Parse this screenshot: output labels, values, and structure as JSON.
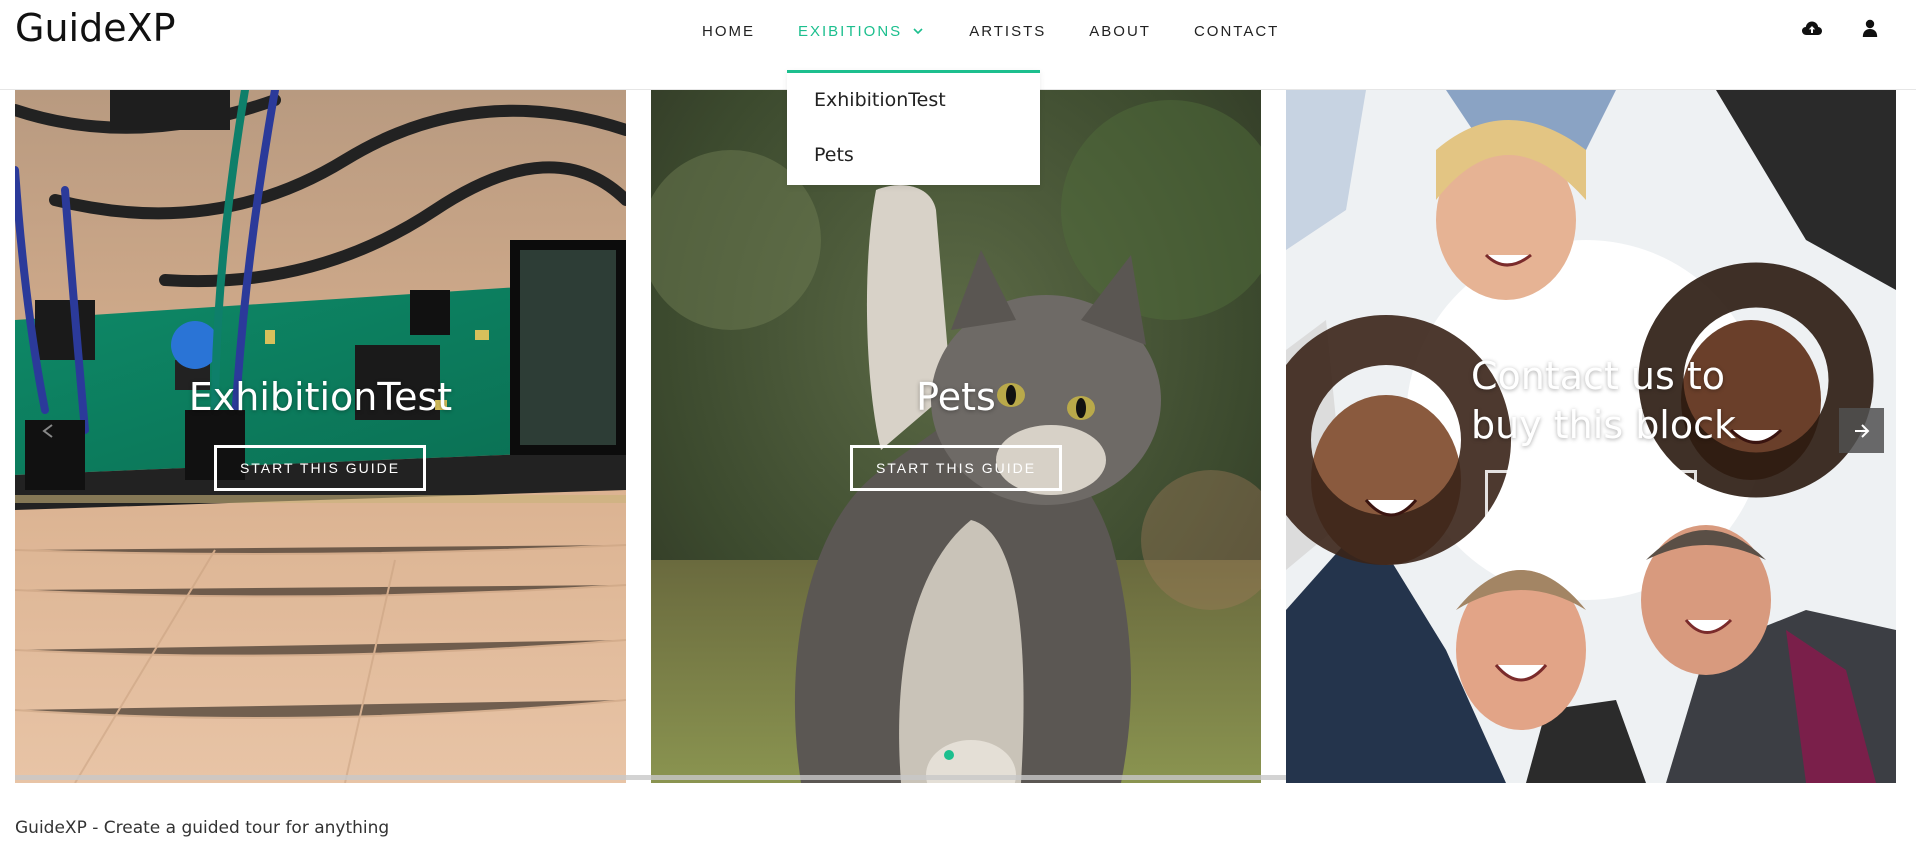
{
  "brand": {
    "name": "GuideXP"
  },
  "nav": {
    "items": [
      {
        "label": "HOME"
      },
      {
        "label": "EXIBITIONS"
      },
      {
        "label": "ARTISTS"
      },
      {
        "label": "ABOUT"
      },
      {
        "label": "CONTACT"
      }
    ],
    "active": "EXIBITIONS"
  },
  "dropdown": {
    "items": [
      {
        "label": "ExhibitionTest"
      },
      {
        "label": "Pets"
      }
    ]
  },
  "header_icons": [
    "cloud-upload-icon",
    "user-icon"
  ],
  "slides": [
    {
      "title": "ExhibitionTest",
      "button": "START THIS GUIDE",
      "image": "circuit-board-photo"
    },
    {
      "title": "Pets",
      "button": "START THIS GUIDE",
      "image": "kitten-photo"
    },
    {
      "title": "Contact us to buy this block",
      "button": "START THIS GUIDE",
      "image": "group-people-circle-photo"
    }
  ],
  "slider": {
    "active_dot": 1,
    "dot_color": "#1cbf8e"
  },
  "footer": {
    "text": "GuideXP - Create a guided tour for anything"
  },
  "colors": {
    "accent": "#1cbf8e",
    "text": "#222222"
  }
}
